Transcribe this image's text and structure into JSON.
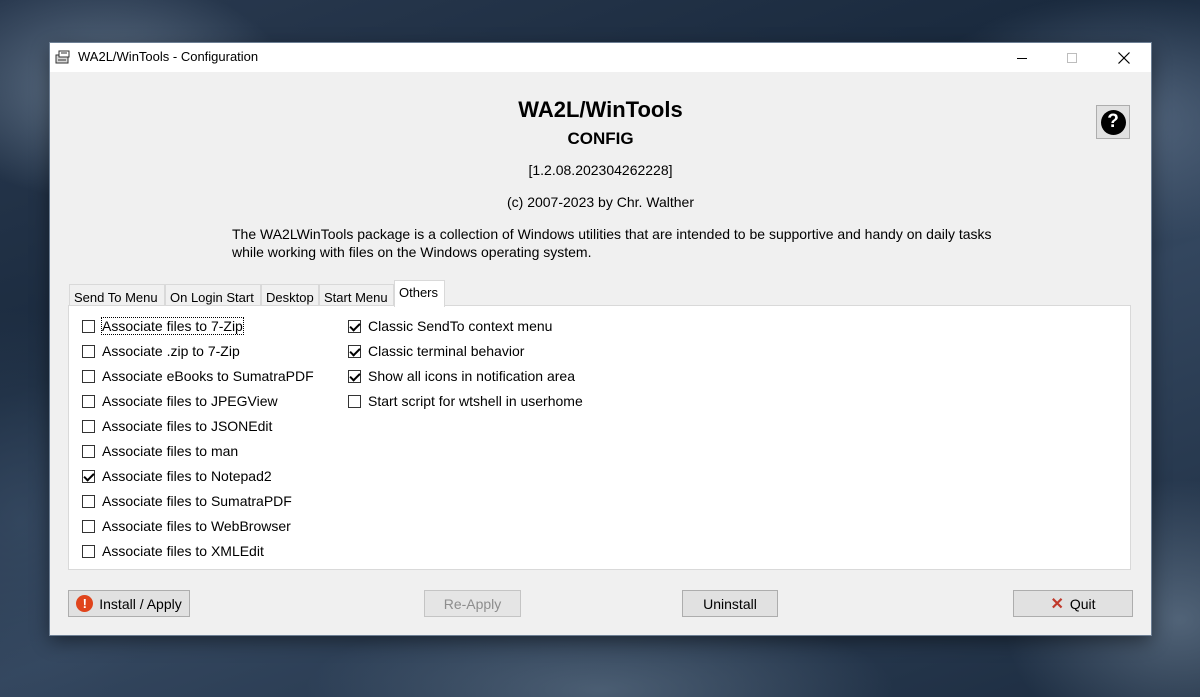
{
  "window": {
    "title": "WA2L/WinTools - Configuration"
  },
  "header": {
    "app_name": "WA2L/WinTools",
    "subtitle": "CONFIG",
    "version": "[1.2.08.202304262228]",
    "copyright": "(c) 2007-2023 by Chr. Walther",
    "description": "The WA2LWinTools package is a collection of Windows utilities that are intended to be supportive and handy on daily tasks while working with files on the Windows operating system."
  },
  "help_button": {
    "glyph": "?"
  },
  "tabs": [
    {
      "label": "Send To Menu",
      "active": false
    },
    {
      "label": "On Login Start",
      "active": false
    },
    {
      "label": "Desktop",
      "active": false
    },
    {
      "label": "Start Menu",
      "active": false
    },
    {
      "label": "Others",
      "active": true
    }
  ],
  "options_left": [
    {
      "label": "Associate files to 7-Zip",
      "checked": false
    },
    {
      "label": "Associate .zip to 7-Zip",
      "checked": false
    },
    {
      "label": "Associate eBooks to SumatraPDF",
      "checked": false
    },
    {
      "label": "Associate files to JPEGView",
      "checked": false
    },
    {
      "label": "Associate files to JSONEdit",
      "checked": false
    },
    {
      "label": "Associate files to man",
      "checked": false
    },
    {
      "label": "Associate files to Notepad2",
      "checked": true
    },
    {
      "label": "Associate files to SumatraPDF",
      "checked": false
    },
    {
      "label": "Associate files to WebBrowser",
      "checked": false
    },
    {
      "label": "Associate files to XMLEdit",
      "checked": false
    }
  ],
  "options_right": [
    {
      "label": "Classic SendTo context menu",
      "checked": true
    },
    {
      "label": "Classic terminal behavior",
      "checked": true
    },
    {
      "label": "Show all icons in notification area",
      "checked": true
    },
    {
      "label": "Start script for wtshell in userhome",
      "checked": false
    }
  ],
  "buttons": {
    "install": "Install / Apply",
    "reapply": "Re-Apply",
    "uninstall": "Uninstall",
    "quit": "Quit"
  },
  "colors": {
    "warning_icon": "#e0441c",
    "quit_icon": "#c0392b"
  }
}
